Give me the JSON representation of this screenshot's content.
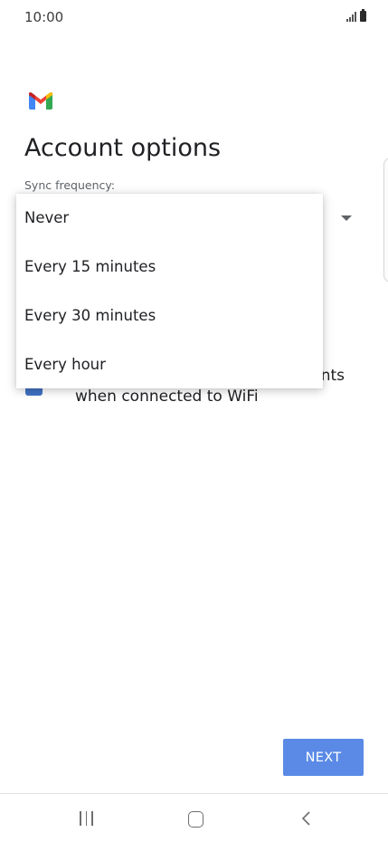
{
  "status_bar": {
    "time": "10:00"
  },
  "header": {
    "app_icon": "gmail-logo",
    "title": "Account options"
  },
  "sync": {
    "label": "Sync frequency:",
    "options": [
      "Never",
      "Every 15 minutes",
      "Every 30 minutes",
      "Every hour"
    ]
  },
  "wifi_attachments": {
    "checked": true,
    "label_line1_visible": "nts",
    "label_line2": "when connected to WiFi"
  },
  "footer": {
    "next_label": "NEXT"
  },
  "nav": {
    "recents_icon": "recents-icon",
    "home_icon": "home-icon",
    "back_icon": "back-icon"
  },
  "colors": {
    "primary_button": "#5a8ae6",
    "checkbox": "#3f72c4",
    "gmail_red": "#ea4335",
    "gmail_blue": "#4285f4",
    "gmail_green": "#34a853",
    "gmail_yellow": "#fbbc04"
  }
}
